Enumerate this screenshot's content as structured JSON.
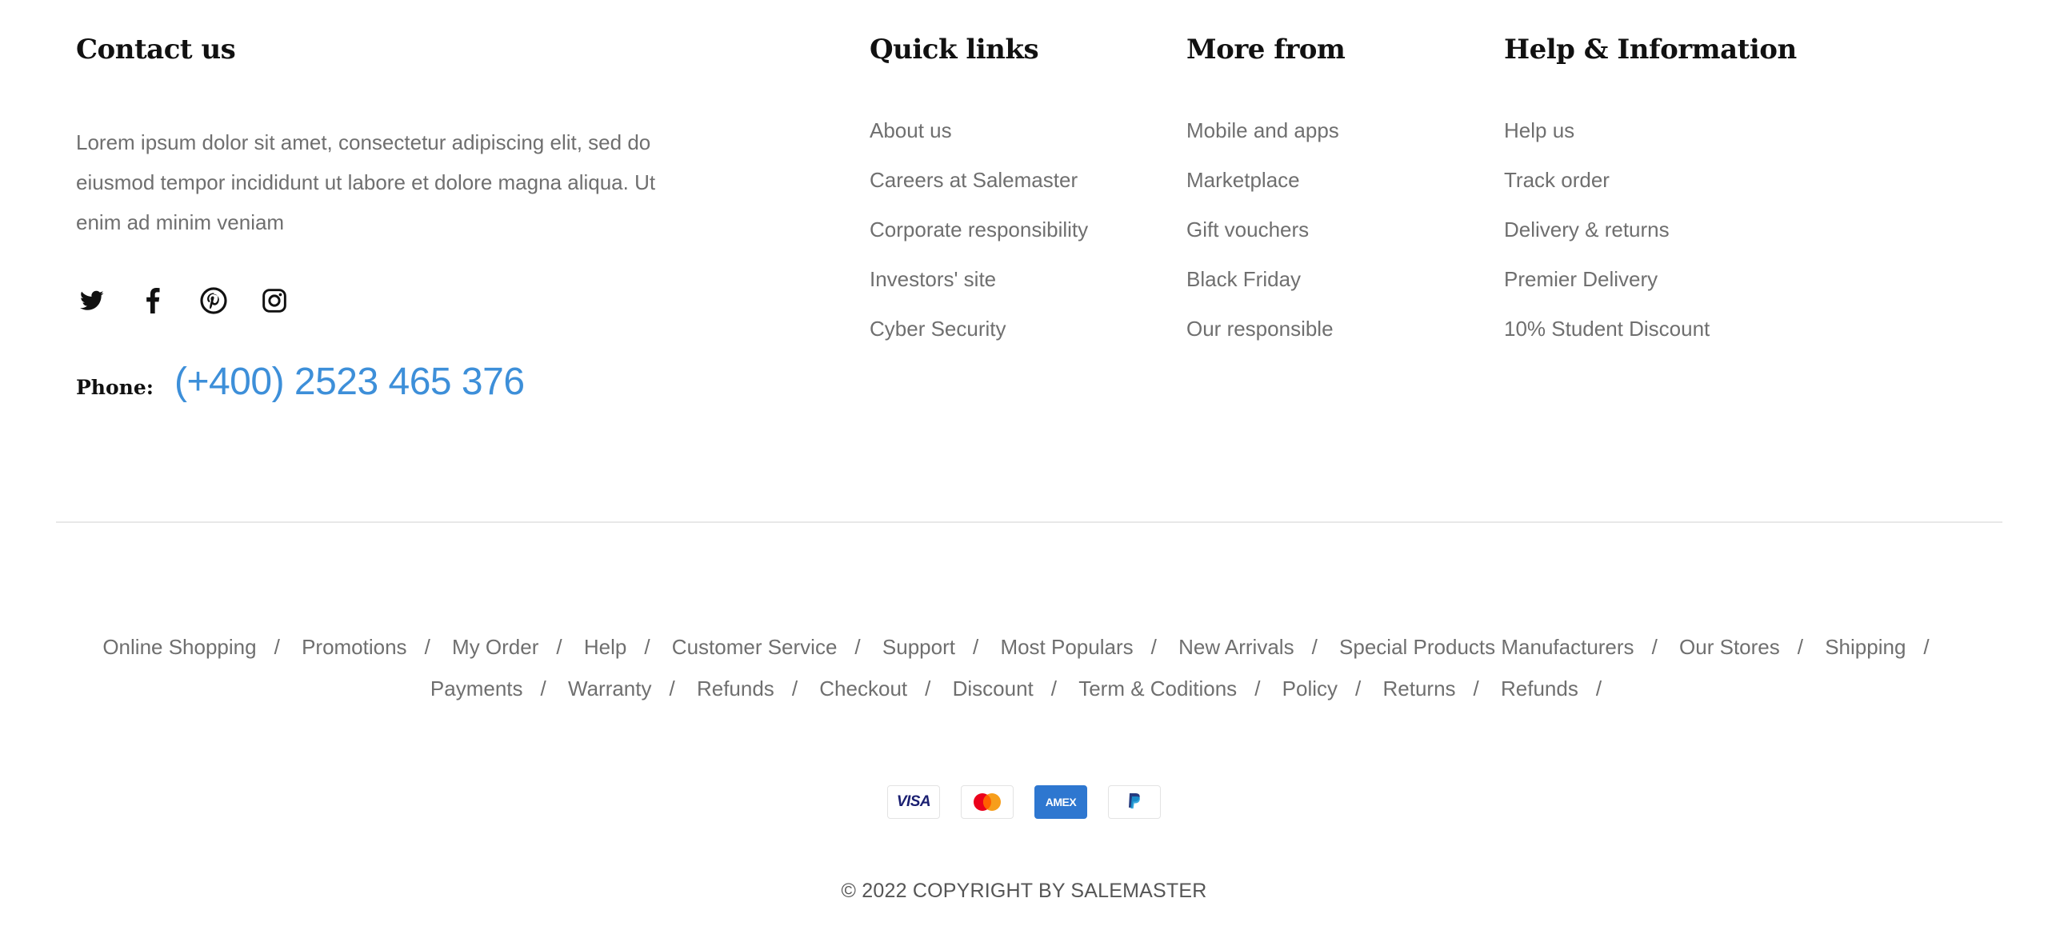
{
  "contact": {
    "heading": "Contact us",
    "description": "Lorem ipsum dolor sit amet, consectetur adipiscing elit, sed do eiusmod tempor incididunt ut labore et dolore magna aliqua. Ut enim ad minim veniam",
    "social_icons": [
      "twitter-icon",
      "facebook-icon",
      "pinterest-icon",
      "instagram-icon"
    ],
    "phone_label": "Phone:",
    "phone_number": "(+400) 2523 465 376",
    "phone_color": "#3d8fd9"
  },
  "quick_links": {
    "heading": "Quick links",
    "items": [
      "About us",
      "Careers at Salemaster",
      "Corporate responsibility",
      "Investors' site",
      "Cyber Security"
    ]
  },
  "more_from": {
    "heading": "More from",
    "items": [
      "Mobile and apps",
      "Marketplace",
      "Gift vouchers",
      "Black Friday",
      "Our responsible"
    ]
  },
  "help_info": {
    "heading": "Help & Information",
    "items": [
      "Help us",
      "Track order",
      "Delivery & returns",
      "Premier Delivery",
      "10% Student Discount"
    ]
  },
  "bottom_links": {
    "separator": "/",
    "items": [
      "Online Shopping",
      "Promotions",
      "My Order",
      "Help",
      "Customer Service",
      "Support",
      "Most Populars",
      "New Arrivals",
      "Special Products Manufacturers",
      "Our Stores",
      "Shipping",
      "Payments",
      "Warranty",
      "Refunds",
      "Checkout",
      "Discount",
      "Term & Coditions",
      "Policy",
      "Returns",
      "Refunds"
    ]
  },
  "payments": {
    "visa_label": "VISA",
    "amex_label": "AMEX",
    "icons": [
      "visa-icon",
      "mastercard-icon",
      "amex-icon",
      "paypal-icon"
    ]
  },
  "copyright": "© 2022 COPYRIGHT BY SALEMASTER"
}
